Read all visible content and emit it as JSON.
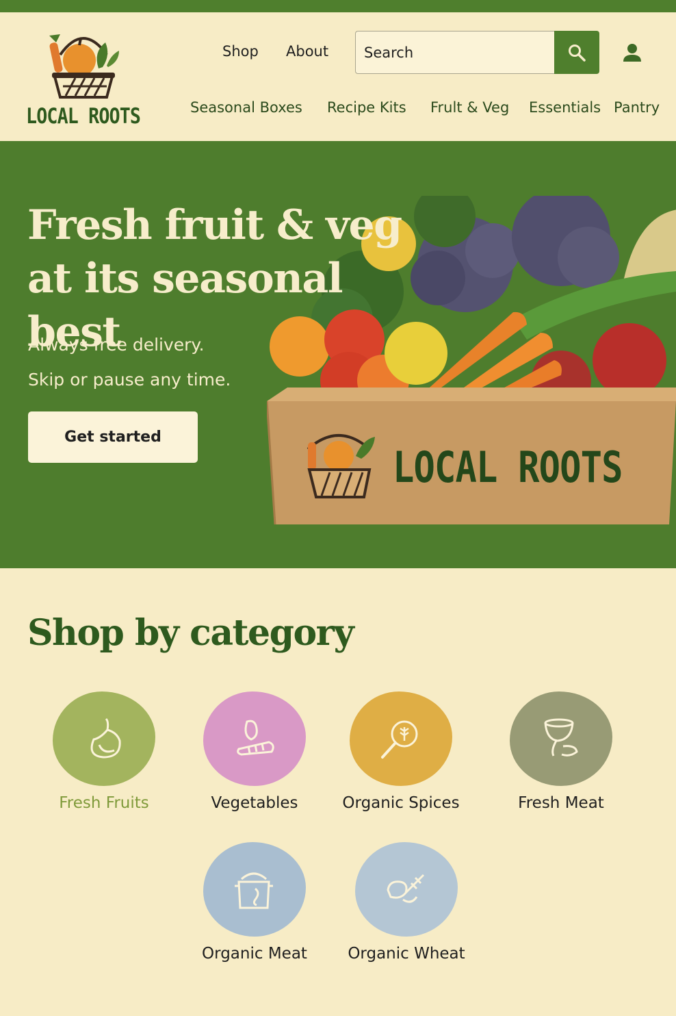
{
  "brand": {
    "name": "LOCAL ROOTS"
  },
  "header": {
    "top_links": [
      "Shop",
      "About"
    ],
    "search": {
      "placeholder": "Search"
    },
    "categories": [
      "Seasonal Boxes",
      "Recipe Kits",
      "Frult & Veg",
      "Essentials",
      "Pantry"
    ]
  },
  "hero": {
    "title_line1": "Fresh fruit & veg",
    "title_line2": "at its seasonal best",
    "subtitle_line1": "Always free delivery.",
    "subtitle_line2": "Skip or pause any time.",
    "cta_label": "Get started",
    "box_brand": "LOCAL ROOTS"
  },
  "shop_section": {
    "title": "Shop by category",
    "items": [
      {
        "label": "Fresh Fruits",
        "color": "#a3b45e",
        "icon": "fruit-icon",
        "active": true
      },
      {
        "label": "Vegetables",
        "color": "#d999c6",
        "icon": "vegetable-icon",
        "active": false
      },
      {
        "label": "Organic Spices",
        "color": "#dfae45",
        "icon": "spice-icon",
        "active": false
      },
      {
        "label": "Fresh Meat",
        "color": "#989b75",
        "icon": "meat-icon",
        "active": false
      },
      {
        "label": "Organic Meat",
        "color": "#a9bed0",
        "icon": "pot-icon",
        "active": false
      },
      {
        "label": "Organic Wheat",
        "color": "#b4c6d4",
        "icon": "wheat-icon",
        "active": false
      }
    ]
  },
  "colors": {
    "brand_green": "#4f7f2d",
    "cream": "#f7ecc6",
    "dark_green": "#2e5a1e"
  }
}
